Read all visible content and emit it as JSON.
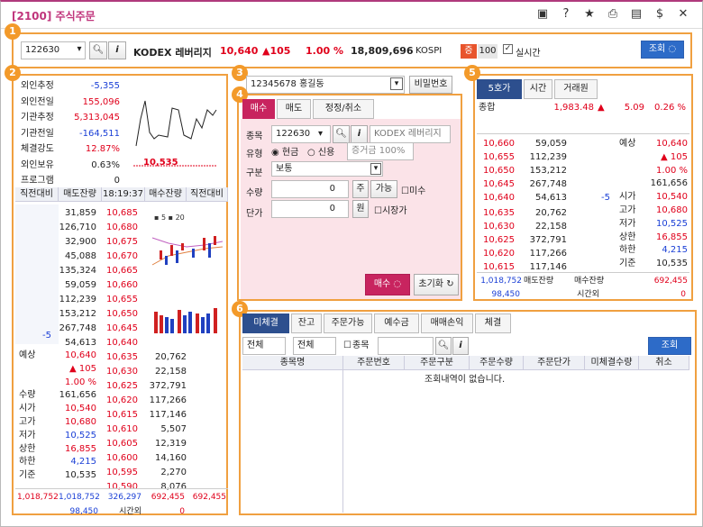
{
  "window": {
    "title": "[2100] 주식주문",
    "icons": [
      "chat-icon",
      "help-icon",
      "star-icon",
      "print-icon",
      "copy-icon",
      "dollar-icon",
      "close-icon"
    ],
    "icon_glyphs": [
      "▣",
      "?",
      "★",
      "⎙",
      "▤",
      "$",
      "✕"
    ]
  },
  "badges": [
    "1",
    "2",
    "3",
    "4",
    "5",
    "6"
  ],
  "top": {
    "code": "122630",
    "name": "KODEX 레버리지",
    "price": "10,640",
    "change": "▲105",
    "rate": "1.00 %",
    "volume": "18,809,696",
    "market": "KOSPI",
    "tag": "증",
    "tag_val": "100",
    "realtime": "실시간",
    "query": "조회"
  },
  "info": {
    "rows": [
      [
        "외인추정",
        "-5,355",
        "blue"
      ],
      [
        "외인전일",
        "155,096",
        "red"
      ],
      [
        "기관추정",
        "5,313,045",
        "red"
      ],
      [
        "기관전일",
        "-164,511",
        "blue"
      ],
      [
        "체결강도",
        "12.87%",
        "red"
      ],
      [
        "외인보유",
        "0.63%",
        ""
      ],
      [
        "프로그램",
        "0",
        ""
      ]
    ],
    "chart_price": "10,535"
  },
  "hoga_left": {
    "headers": [
      "직전대비",
      "매도잔량",
      "18:19:37",
      "매수잔량",
      "직전대비"
    ],
    "sell_qty": [
      "31,859",
      "126,710",
      "32,900",
      "45,088",
      "135,324",
      "59,059",
      "112,239",
      "153,212",
      "267,748",
      "54,613"
    ],
    "sell_price": [
      "10,685",
      "10,680",
      "10,675",
      "10,670",
      "10,665",
      "10,660",
      "10,655",
      "10,650",
      "10,645",
      "10,640"
    ],
    "sell_diff": "-5",
    "legend": "▪ 5 ▪ 20",
    "buy_price": [
      "10,635",
      "10,630",
      "10,625",
      "10,620",
      "10,615",
      "10,610",
      "10,605",
      "10,600",
      "10,595",
      "10,590"
    ],
    "buy_qty": [
      "20,762",
      "22,158",
      "372,791",
      "117,266",
      "117,146",
      "5,507",
      "12,319",
      "14,160",
      "2,270",
      "8,076"
    ],
    "summary": [
      [
        "예상",
        "10,640",
        "red"
      ],
      [
        "",
        "▲ 105",
        "red"
      ],
      [
        "",
        "1.00 %",
        "red"
      ],
      [
        "수량",
        "161,656",
        ""
      ],
      [
        "시가",
        "10,540",
        "red"
      ],
      [
        "고가",
        "10,680",
        "red"
      ],
      [
        "저가",
        "10,525",
        "blue"
      ],
      [
        "상한",
        "16,855",
        "red"
      ],
      [
        "하한",
        "4,215",
        "blue"
      ],
      [
        "기준",
        "10,535",
        ""
      ]
    ],
    "footer": [
      "1,018,752",
      "1,018,752",
      "326,297",
      "692,455",
      "692,455"
    ],
    "footer2": [
      "98,450",
      "시간외",
      "0"
    ]
  },
  "account": {
    "value": "12345678 홍길동",
    "pw": "비밀번호"
  },
  "order": {
    "tabs": [
      "매수",
      "매도",
      "정정/취소"
    ],
    "code_label": "종목",
    "code": "122630",
    "name": "KODEX 레버리지",
    "type_label": "유형",
    "type_opts": [
      "현금",
      "신용"
    ],
    "margin": "증거금 100%",
    "class_label": "구분",
    "class_val": "보통",
    "qty_label": "수량",
    "qty": "0",
    "unit": "주",
    "avail": "가능",
    "no_qty": "미수",
    "price_label": "단가",
    "price": "0",
    "won": "원",
    "market_price": "시장가",
    "buy_btn": "매수",
    "reset_btn": "초기화"
  },
  "quote5": {
    "tabs": [
      "5호가",
      "시간",
      "거래원"
    ],
    "total_label": "종합",
    "total_price": "1,983.48",
    "total_change": "▲",
    "total_chg_val": "5.09",
    "total_rate": "0.26 %",
    "sell_price": [
      "10,660",
      "10,655",
      "10,650",
      "10,645",
      "10,640"
    ],
    "sell_qty": [
      "59,059",
      "112,239",
      "153,212",
      "267,748",
      "54,613"
    ],
    "buy_price": [
      "10,635",
      "10,630",
      "10,625",
      "10,620",
      "10,615"
    ],
    "buy_qty": [
      "20,762",
      "22,158",
      "372,791",
      "117,266",
      "117,146"
    ],
    "diff": "-5",
    "right": [
      [
        "예상",
        "10,640",
        "red"
      ],
      [
        "",
        "▲ 105",
        "red"
      ],
      [
        "",
        "1.00 %",
        "red"
      ],
      [
        "",
        "161,656",
        ""
      ],
      [
        "시가",
        "10,540",
        "red"
      ],
      [
        "고가",
        "10,680",
        "red"
      ],
      [
        "저가",
        "10,525",
        "blue"
      ],
      [
        "상한",
        "16,855",
        "red"
      ],
      [
        "하한",
        "4,215",
        "blue"
      ],
      [
        "기준",
        "10,535",
        ""
      ]
    ],
    "foot": [
      "1,018,752",
      "매도잔량",
      "매수잔량",
      "692,455"
    ],
    "foot2": [
      "98,450",
      "시간외",
      "0"
    ]
  },
  "orders": {
    "tabs": [
      "미체결",
      "잔고",
      "주문가능",
      "예수금",
      "매매손익",
      "체결"
    ],
    "filter1": "전체",
    "filter2": "전체",
    "stock": "종목",
    "query": "조회",
    "headers": [
      "종목명",
      "주문번호",
      "주문구분",
      "주문수량",
      "주문단가",
      "미체결수량",
      "취소"
    ],
    "empty": "조회내역이 없습니다."
  }
}
